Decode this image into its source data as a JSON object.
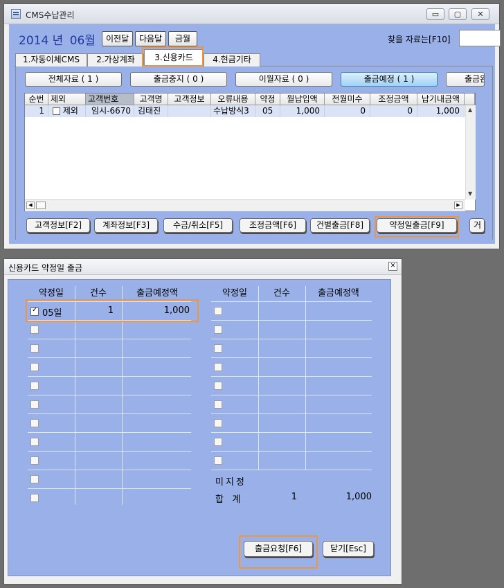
{
  "main_window": {
    "title": "CMS수납관리",
    "controls": {
      "minimize": "▭",
      "maximize": "▢",
      "close": "✕"
    },
    "period": {
      "year": "2014",
      "year_unit": "년",
      "month": "06",
      "month_unit": "월"
    },
    "nav_buttons": {
      "prev": "이전달",
      "next": "다음달",
      "current": "금월"
    },
    "search": {
      "label": "찾을 자료는[F10]",
      "value": ""
    },
    "tabs": [
      {
        "label": "1.자동이체CMS"
      },
      {
        "label": "2.가상계좌"
      },
      {
        "label": "3.신용카드",
        "active": true
      },
      {
        "label": "4.현금기타"
      }
    ],
    "filters": [
      {
        "label": "전체자료 ( 1 )"
      },
      {
        "label": "출금중지 ( 0 )"
      },
      {
        "label": "이월자료 ( 0 )"
      },
      {
        "label": "출금예정 ( 1 )",
        "active": true
      },
      {
        "label": "출금완"
      }
    ],
    "grid": {
      "columns": [
        "순번",
        "제외",
        "고객번호",
        "고객명",
        "고객정보",
        "오류내용",
        "약정",
        "월납입액",
        "전월미수",
        "조정금액",
        "납기내금액"
      ],
      "rows": [
        {
          "no": "1",
          "exclude_label": "제외",
          "customer_no": "임시-6670",
          "customer_name": "김태진",
          "customer_info": "",
          "error": "수납방식3",
          "contract": "05",
          "monthly": "1,000",
          "prev_unpaid": "0",
          "adjust": "0",
          "due_amount": "1,000"
        }
      ]
    },
    "bottom_buttons": [
      {
        "label": "고객정보[F2]"
      },
      {
        "label": "계좌정보[F3]"
      },
      {
        "label": "수금/취소[F5]"
      },
      {
        "label": "조정금액[F6]"
      },
      {
        "label": "건별출금[F8]"
      },
      {
        "label": "약정일출금[F9]"
      },
      {
        "label": "거"
      }
    ]
  },
  "dialog": {
    "title": "신용카드 약정일 출금",
    "close": "✕",
    "left_table": {
      "headers": [
        "약정일",
        "건수",
        "출금예정액"
      ],
      "rows": [
        {
          "checked": true,
          "day": "05일",
          "count": "1",
          "amount": "1,000"
        }
      ]
    },
    "right_table": {
      "headers": [
        "약정일",
        "건수",
        "출금예정액"
      ]
    },
    "unassigned_label": "미지정",
    "total": {
      "label": "합   계",
      "count": "1",
      "amount": "1,000"
    },
    "buttons": {
      "request": "출금요청[F6]",
      "close": "닫기[Esc]"
    }
  },
  "colors": {
    "client_bg": "#9ab0e8",
    "highlight": "#f0963c",
    "active_filter": "#9fd2f5",
    "period_text": "#1d3a9a"
  }
}
